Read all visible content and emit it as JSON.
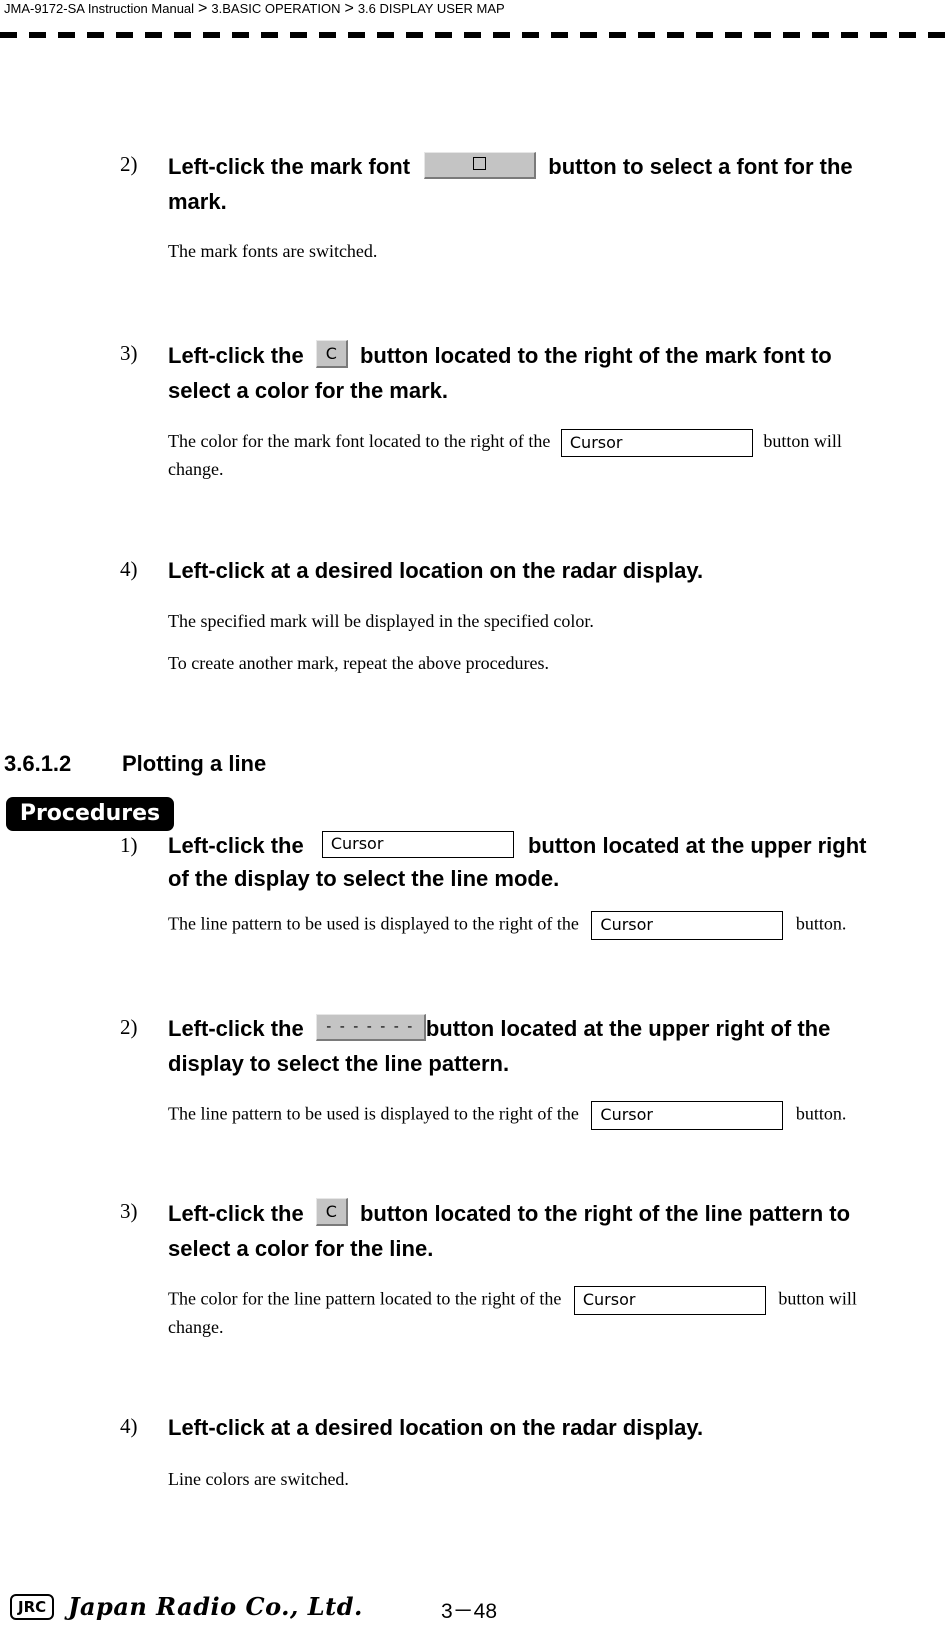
{
  "header": {
    "breadcrumb": [
      "JMA-9172-SA Instruction Manual",
      "3.BASIC OPERATION",
      "3.6  DISPLAY USER MAP"
    ],
    "separator": ">"
  },
  "mark_steps": [
    {
      "number": "2)",
      "text_before": "Left-click the mark font",
      "button": {
        "type": "font",
        "label": "□"
      },
      "text_after": "button to select a font for the",
      "text_line2": "mark.",
      "description": "The mark fonts are switched."
    },
    {
      "number": "3)",
      "text_before": "Left-click the",
      "button": {
        "type": "color",
        "label": "C"
      },
      "text_after": "button located to the right of the mark font to",
      "text_line2": "select a color for the mark.",
      "description_before": " The color for the mark font located to the right of the",
      "description_button": "Cursor",
      "description_after": "button will",
      "description_line2": "change."
    },
    {
      "number": "4)",
      "text": "Left-click at a desired location on the radar display.",
      "descriptions": [
        "The specified mark will be displayed in the specified color.",
        "To create another mark, repeat the above procedures."
      ]
    }
  ],
  "section": {
    "number": "3.6.1.2",
    "title": "Plotting a line",
    "badge": "Procedures"
  },
  "line_steps": [
    {
      "number": "1)",
      "text_before": "Left-click the",
      "button": {
        "type": "mode",
        "label": "Cursor"
      },
      "text_after": "button located at the upper right",
      "text_line2": "of the display to select the line mode.",
      "description_before": "The line pattern to be used is displayed to the right of the",
      "description_button": "Cursor",
      "description_after": "button."
    },
    {
      "number": "2)",
      "text_before": "Left-click the",
      "button": {
        "type": "pattern",
        "label": "- - - - - - -"
      },
      "text_after": "button located at the upper right of the",
      "text_line2": "display to select the line pattern.",
      "description_before": "The line pattern to be used is displayed to the right of the",
      "description_button": "Cursor",
      "description_after": "button."
    },
    {
      "number": "3)",
      "text_before": "Left-click the",
      "button": {
        "type": "color",
        "label": "C"
      },
      "text_after": "button located to the right of the line pattern to",
      "text_line2": "select a color for the line.",
      "description_before": "The color for the line pattern located to the right of the",
      "description_button": "Cursor",
      "description_after": "button will",
      "description_line2": "change."
    },
    {
      "number": "4)",
      "text": "Left-click at a desired location on the radar display.",
      "description": "Line colors are switched."
    }
  ],
  "footer": {
    "logo_badge": "JRC",
    "company": "Japan Radio Co., Ltd.",
    "page_number": "3－48"
  }
}
